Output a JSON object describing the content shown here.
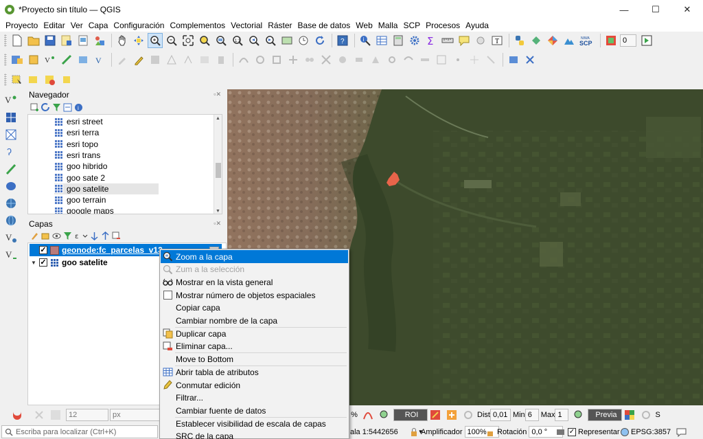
{
  "window": {
    "title": "*Proyecto sin título — QGIS",
    "minimize": "—",
    "maximize": "☐",
    "close": "✕"
  },
  "menu": [
    "Proyecto",
    "Editar",
    "Ver",
    "Capa",
    "Configuración",
    "Complementos",
    "Vectorial",
    "Ráster",
    "Base de datos",
    "Web",
    "Malla",
    "SCP",
    "Procesos",
    "Ayuda"
  ],
  "toolbar": {
    "scp_label": "SCP",
    "niwa_label": "NIWA",
    "zero_value": "0"
  },
  "navigator": {
    "title": "Navegador",
    "items": [
      "esri street",
      "esri terra",
      "esri topo",
      "esri trans",
      "goo hibrido",
      "goo sate 2",
      "goo satelite",
      "goo terrain",
      "google maps"
    ],
    "selected_index": 6
  },
  "layers": {
    "title": "Capas",
    "items": [
      {
        "name": "geonode:fc_parcelas_v13",
        "checked": true,
        "selected": true,
        "type": "polygon"
      },
      {
        "name": "goo satelite",
        "checked": true,
        "selected": false,
        "type": "raster"
      }
    ]
  },
  "context_menu": {
    "items": [
      {
        "label": "Zoom a la capa",
        "highlighted": true,
        "disabled": false,
        "icon": "zoom-layer-icon"
      },
      {
        "label": "Zum a la selección",
        "highlighted": false,
        "disabled": true,
        "icon": "zoom-selection-icon"
      },
      {
        "label": "Mostrar en la vista general",
        "highlighted": false,
        "disabled": false,
        "icon": "glasses-icon"
      },
      {
        "label": "Mostrar número de objetos espaciales",
        "highlighted": false,
        "disabled": false,
        "icon": "checkbox-icon"
      },
      {
        "label": "Copiar capa",
        "highlighted": false,
        "disabled": false,
        "icon": ""
      },
      {
        "label": "Cambiar nombre de la capa",
        "highlighted": false,
        "disabled": false,
        "icon": ""
      },
      {
        "label": "Duplicar capa",
        "highlighted": false,
        "disabled": false,
        "icon": "duplicate-icon",
        "sep_before": true
      },
      {
        "label": "Eliminar capa...",
        "highlighted": false,
        "disabled": false,
        "icon": "remove-layer-icon"
      },
      {
        "label": "Move to Bottom",
        "highlighted": false,
        "disabled": false,
        "icon": "",
        "sep_before": true
      },
      {
        "label": "Abrir tabla de atributos",
        "highlighted": false,
        "disabled": false,
        "icon": "attribute-table-icon",
        "sep_before": true
      },
      {
        "label": "Conmutar edición",
        "highlighted": false,
        "disabled": false,
        "icon": "pencil-icon"
      },
      {
        "label": "Filtrar...",
        "highlighted": false,
        "disabled": false,
        "icon": ""
      },
      {
        "label": "Cambiar fuente de datos",
        "highlighted": false,
        "disabled": false,
        "icon": ""
      },
      {
        "label": "Establecer visibilidad de escala de capas",
        "highlighted": false,
        "disabled": false,
        "icon": "",
        "sep_before": true
      },
      {
        "label": "SRC de la capa",
        "highlighted": false,
        "disabled": false,
        "icon": ""
      }
    ]
  },
  "stylebar": {
    "size_value": "12",
    "unit": "px",
    "roi": "ROI",
    "dist_label": "Dist",
    "dist_value": "0,01",
    "min_label": "Min",
    "min_value": "6",
    "max_label": "Max",
    "max_value": "1",
    "preview": "Previa",
    "s_label": "S"
  },
  "status": {
    "locator_placeholder": "Escriba para localizar (Ctrl+K)",
    "scale_label": "ala",
    "scale_value": "1:5442656",
    "magnifier_label": "Amplificador",
    "magnifier_value": "100%",
    "rotation_label": "Rotación",
    "rotation_value": "0,0 °",
    "render_label": "Representar",
    "crs": "EPSG:3857"
  },
  "colors": {
    "accent": "#0078d7",
    "qgis_green": "#589632",
    "parcel": "#e8644a"
  }
}
